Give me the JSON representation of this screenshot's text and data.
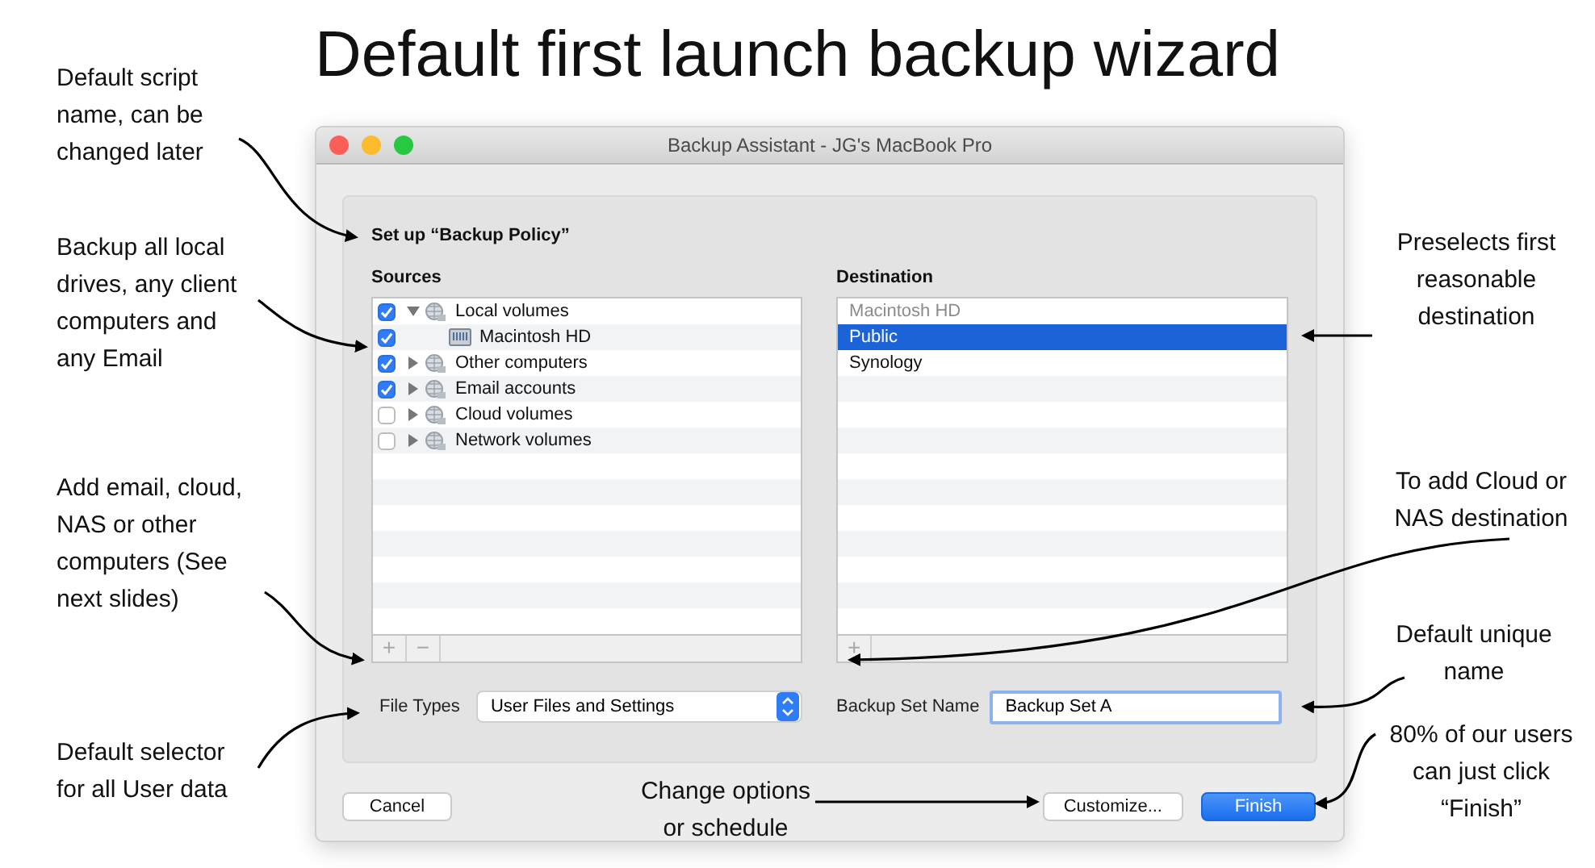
{
  "slide_title": "Default first launch backup wizard",
  "annotations": [
    {
      "text": "Default script name, can be changed later"
    },
    {
      "text": "Backup all local drives, any client computers and any Email"
    },
    {
      "text": "Add email, cloud, NAS or other computers (See next slides)"
    },
    {
      "text": "Default selector for all User data"
    },
    {
      "text": "Change options or schedule"
    },
    {
      "text": "Preselects first reasonable destination"
    },
    {
      "text": "To add Cloud or NAS destination"
    },
    {
      "text": "Default unique name"
    },
    {
      "text": "80% of our users can just click “Finish”"
    }
  ],
  "window": {
    "title": "Backup Assistant - JG's MacBook Pro"
  },
  "heading": "Set up “Backup Policy”",
  "sources": {
    "label": "Sources",
    "items": [
      {
        "label": "Local volumes",
        "checked": true,
        "expanded": true,
        "children": [
          {
            "label": "Macintosh HD",
            "checked": true
          }
        ]
      },
      {
        "label": "Other computers",
        "checked": true,
        "expanded": false
      },
      {
        "label": "Email accounts",
        "checked": true,
        "expanded": false
      },
      {
        "label": "Cloud volumes",
        "checked": false,
        "expanded": false
      },
      {
        "label": "Network volumes",
        "checked": false,
        "expanded": false
      }
    ],
    "controls": [
      "+",
      "−"
    ]
  },
  "destination": {
    "label": "Destination",
    "items": [
      {
        "label": "Macintosh HD",
        "disabled": true,
        "selected": false
      },
      {
        "label": "Public",
        "disabled": false,
        "selected": true
      },
      {
        "label": "Synology",
        "disabled": false,
        "selected": false
      }
    ],
    "controls": [
      "+"
    ]
  },
  "file_types": {
    "label": "File Types",
    "value": "User Files and Settings"
  },
  "backup_set_name": {
    "label": "Backup Set Name",
    "value": "Backup Set A"
  },
  "buttons": [
    {
      "label": "Cancel",
      "kind": "plain"
    },
    {
      "label": "Customize...",
      "kind": "plain"
    },
    {
      "label": "Finish",
      "kind": "default"
    }
  ]
}
